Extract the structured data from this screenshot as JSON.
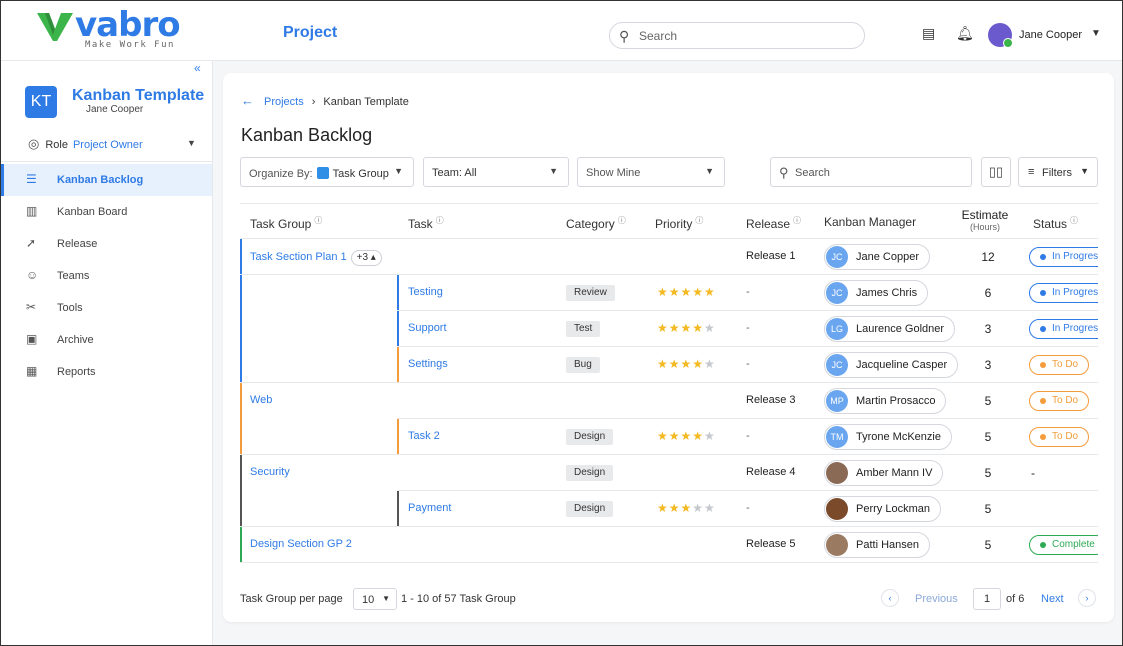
{
  "header": {
    "logo_word": "vabro",
    "logo_tagline": "Make Work Fun",
    "app_title": "Project",
    "search_placeholder": "Search",
    "user_name": "Jane Cooper"
  },
  "sidebar": {
    "project_initials": "KT",
    "project_name": "Kanban Template",
    "project_owner": "Jane Cooper",
    "role_label": "Role",
    "role_value": "Project Owner",
    "items": [
      {
        "label": "Kanban Backlog",
        "icon": "list-icon",
        "active": true
      },
      {
        "label": "Kanban Board",
        "icon": "board-icon"
      },
      {
        "label": "Release",
        "icon": "rocket-icon"
      },
      {
        "label": "Teams",
        "icon": "teams-icon"
      },
      {
        "label": "Tools",
        "icon": "tools-icon"
      },
      {
        "label": "Archive",
        "icon": "archive-icon"
      },
      {
        "label": "Reports",
        "icon": "reports-icon"
      }
    ]
  },
  "main": {
    "breadcrumb": {
      "root": "Projects",
      "current": "Kanban Template"
    },
    "title": "Kanban Backlog",
    "toolbar": {
      "organize_label": "Organize By:",
      "organize_value": "Task Group",
      "team_label": "Team: All",
      "show_label": "Show Mine",
      "search_placeholder": "Search",
      "filters_label": "Filters"
    },
    "columns": {
      "task_group": "Task Group",
      "task": "Task",
      "category": "Category",
      "priority": "Priority",
      "release": "Release",
      "manager": "Kanban Manager",
      "estimate": "Estimate",
      "estimate_unit": "(Hours)",
      "status": "Status"
    },
    "rows": [
      {
        "group": "Task Section Plan 1",
        "group_more": "+3 ▴",
        "task": "",
        "category": "",
        "priority": 0,
        "release": "Release 1",
        "manager_initials": "JC",
        "manager": "Jane Copper",
        "estimate": "12",
        "status": "In Progress"
      },
      {
        "group": "",
        "task": "Testing",
        "category": "Review",
        "priority": 5,
        "release": "-",
        "manager_initials": "JC",
        "manager": "James Chris",
        "estimate": "6",
        "status": "In Progress"
      },
      {
        "group": "",
        "task": "Support",
        "category": "Test",
        "priority": 4,
        "release": "-",
        "manager_initials": "LG",
        "manager": "Laurence Goldner",
        "estimate": "3",
        "status": "In Progress"
      },
      {
        "group": "",
        "task": "Settings",
        "category": "Bug",
        "priority": 4,
        "release": "-",
        "manager_initials": "JC",
        "manager": "Jacqueline Casper",
        "estimate": "3",
        "status": "To Do"
      },
      {
        "group": "Web",
        "task": "",
        "category": "",
        "priority": 0,
        "release": "Release 3",
        "manager_initials": "MP",
        "manager": "Martin Prosacco",
        "estimate": "5",
        "status": "To Do"
      },
      {
        "group": "",
        "task": "Task 2",
        "category": "Design",
        "priority": 4,
        "release": "-",
        "manager_initials": "TM",
        "manager": "Tyrone McKenzie",
        "estimate": "5",
        "status": "To Do"
      },
      {
        "group": "Security",
        "task": "",
        "category": "Design",
        "priority": 0,
        "release": "Release 4",
        "manager_initials": "",
        "manager": "Amber Mann IV",
        "estimate": "5",
        "status": "-"
      },
      {
        "group": "",
        "task": "Payment",
        "category": "Design",
        "priority": 3,
        "release": "-",
        "manager_initials": "",
        "manager": "Perry Lockman",
        "estimate": "5",
        "status": ""
      },
      {
        "group": "Design Section GP 2",
        "task": "",
        "category": "",
        "priority": 0,
        "release": "Release 5",
        "manager_initials": "",
        "manager": "Patti Hansen",
        "estimate": "5",
        "status": "Complete"
      }
    ],
    "footer": {
      "per_page_label": "Task Group per page",
      "per_page_value": "10",
      "range_label": "1 - 10 of 57 Task Group",
      "previous": "Previous",
      "page": "1",
      "of_pages": "of 6",
      "next": "Next"
    }
  },
  "colors": {
    "accent": "#2f7be6",
    "in_progress": "#2f7be6",
    "to_do": "#f39c3c",
    "complete": "#2eaa55",
    "star": "#f4b820"
  }
}
